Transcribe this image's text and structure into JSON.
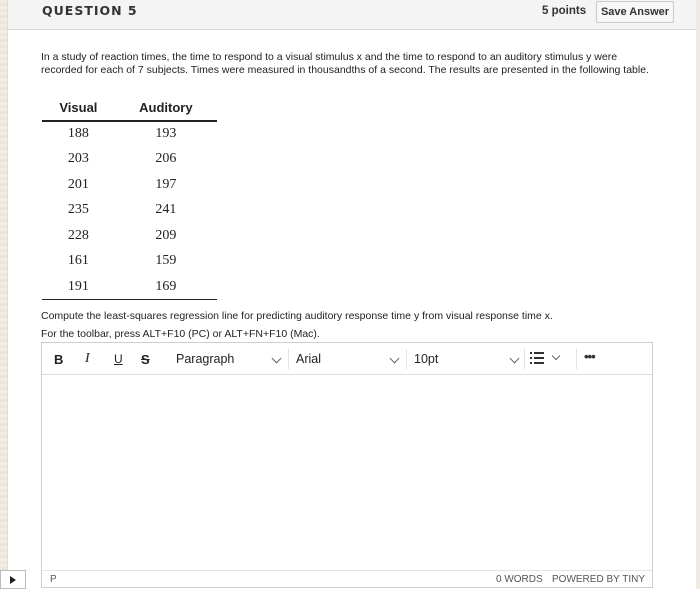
{
  "header": {
    "question_title": "QUESTION 5",
    "points": "5 points",
    "save_label": "Save Answer"
  },
  "question": {
    "text": "In a study of reaction times, the time to respond to a visual stimulus x and the time to respond to an auditory stimulus y were recorded for each of 7 subjects. Times were measured in thousandths of a second. The results are presented in the following table.",
    "table": {
      "headers": [
        "Visual",
        "Auditory"
      ],
      "rows": [
        [
          "188",
          "193"
        ],
        [
          "203",
          "206"
        ],
        [
          "201",
          "197"
        ],
        [
          "235",
          "241"
        ],
        [
          "228",
          "209"
        ],
        [
          "161",
          "159"
        ],
        [
          "191",
          "169"
        ]
      ]
    },
    "prompt": "Compute the least-squares regression line for predicting auditory response time y from visual response time x.",
    "toolbar_hint": "For the toolbar, press ALT+F10 (PC) or ALT+FN+F10 (Mac)."
  },
  "editor": {
    "toolbar": {
      "bold": "B",
      "italic": "I",
      "underline": "U",
      "strikethrough": "S",
      "block_format": "Paragraph",
      "font_family": "Arial",
      "font_size": "10pt",
      "list_icon": "bullet-list-icon",
      "more": "•••"
    },
    "status": {
      "path": "P",
      "word_count": "0 WORDS",
      "powered_by": "POWERED BY TINY"
    }
  }
}
